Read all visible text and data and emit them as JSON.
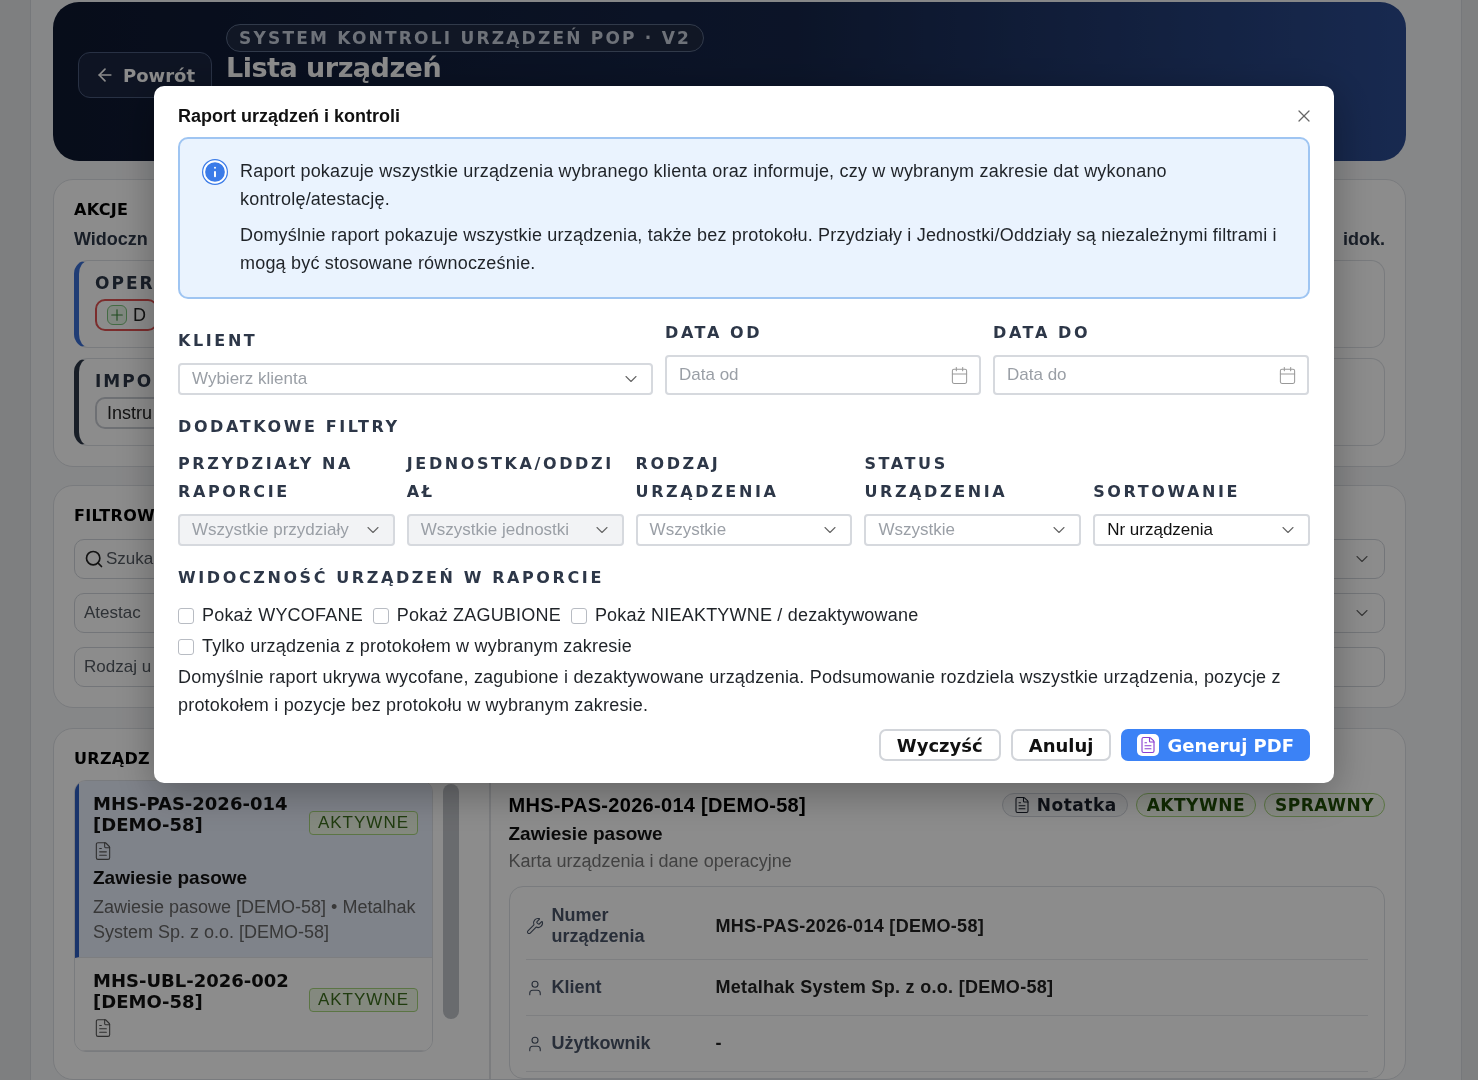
{
  "header": {
    "badge": "SYSTEM KONTROLI URZĄDZEŃ POP · V2",
    "back_button": "Powrót",
    "title": "Lista urządzeń"
  },
  "actions": {
    "title": "AKCJE",
    "hint": "Widoczn",
    "hint_end": "idok.",
    "groups": [
      {
        "title": "OPER",
        "kind": "add",
        "button": "D"
      },
      {
        "title": "IMPO",
        "kind": "plain",
        "button": "Instru"
      }
    ]
  },
  "filters": {
    "title": "FILTROW",
    "fields": [
      {
        "kind": "search",
        "placeholder": "Szuka"
      },
      {
        "kind": "select",
        "placeholder": "Atestac"
      },
      {
        "kind": "plain",
        "placeholder": "Rodzaj u"
      }
    ]
  },
  "devices": {
    "title": "URZĄDZ",
    "items": [
      {
        "code": "MHS-PAS-2026-014 [DEMO-58]",
        "status": "AKTYWNE",
        "name": "Zawiesie pasowe",
        "description": "Zawiesie pasowe [DEMO-58] • Metalhak System Sp. z o.o. [DEMO-58]",
        "selected": true
      },
      {
        "code": "MHS-UBL-2026-002 [DEMO-58]",
        "status": "AKTYWNE",
        "selected": false
      }
    ]
  },
  "detail": {
    "title": "MHS-PAS-2026-014 [DEMO-58]",
    "badges": [
      {
        "kind": "note",
        "label": "Notatka"
      },
      {
        "kind": "status",
        "label": "AKTYWNE"
      },
      {
        "kind": "status",
        "label": "SPRAWNY"
      }
    ],
    "name": "Zawiesie pasowe",
    "subtitle": "Karta urządzenia i dane operacyjne",
    "rows": [
      {
        "kind": "tool",
        "label": "Numer urządzenia",
        "value": "MHS-PAS-2026-014 [DEMO-58]"
      },
      {
        "kind": "person",
        "label": "Klient",
        "value": "Metalhak System Sp. z o.o. [DEMO-58]"
      },
      {
        "kind": "person",
        "label": "Użytkownik",
        "value": "-"
      }
    ]
  },
  "modal": {
    "title": "Raport urządzeń i kontroli",
    "info": [
      "Raport pokazuje wszystkie urządzenia wybranego klienta oraz informuje, czy w wybranym zakresie dat wykonano kontrolę/atestację.",
      "Domyślnie raport pokazuje wszystkie urządzenia, także bez protokołu. Przydziały i Jednostki/Oddziały są niezależnymi filtrami i mogą być stosowane równocześnie."
    ],
    "client": {
      "label": "KLIENT",
      "placeholder": "Wybierz klienta"
    },
    "date_from": {
      "label": "DATA OD",
      "placeholder": "Data od"
    },
    "date_to": {
      "label": "DATA DO",
      "placeholder": "Data do"
    },
    "extra_title": "DODATKOWE FILTRY",
    "filters": [
      {
        "label": "PRZYDZIAŁY NA RAPORCIE",
        "placeholder": "Wszystkie przydziały",
        "disabled": true
      },
      {
        "label": "JEDNOSTKA/ODDZIAŁ",
        "placeholder": "Wszystkie jednostki",
        "disabled": true
      },
      {
        "label": "RODZAJ URZĄDZENIA",
        "placeholder": "Wszystkie",
        "disabled": false
      },
      {
        "label": "STATUS URZĄDZENIA",
        "placeholder": "Wszystkie",
        "disabled": false
      },
      {
        "label": "SORTOWANIE",
        "value": "Nr urządzenia",
        "disabled": false
      }
    ],
    "visibility_title": "WIDOCZNOŚĆ URZĄDZEŃ W RAPORCIE",
    "checkboxes": [
      {
        "label": "Pokaż WYCOFANE",
        "checked": false
      },
      {
        "label": "Pokaż ZAGUBIONE",
        "checked": false
      },
      {
        "label": "Pokaż NIEAKTYWNE / dezaktywowane",
        "checked": false
      },
      {
        "label": "Tylko urządzenia z protokołem w wybranym zakresie",
        "checked": false
      }
    ],
    "note": "Domyślnie raport ukrywa wycofane, zagubione i dezaktywowane urządzenia. Podsumowanie rozdziela wszystkie urządzenia, pozycje z protokołem i pozycje bez protokołu w wybranym zakresie.",
    "buttons": [
      {
        "kind": "secondary",
        "label": "Wyczyść"
      },
      {
        "kind": "secondary",
        "label": "Anuluj"
      },
      {
        "kind": "primary",
        "label": "Generuj PDF"
      }
    ]
  }
}
